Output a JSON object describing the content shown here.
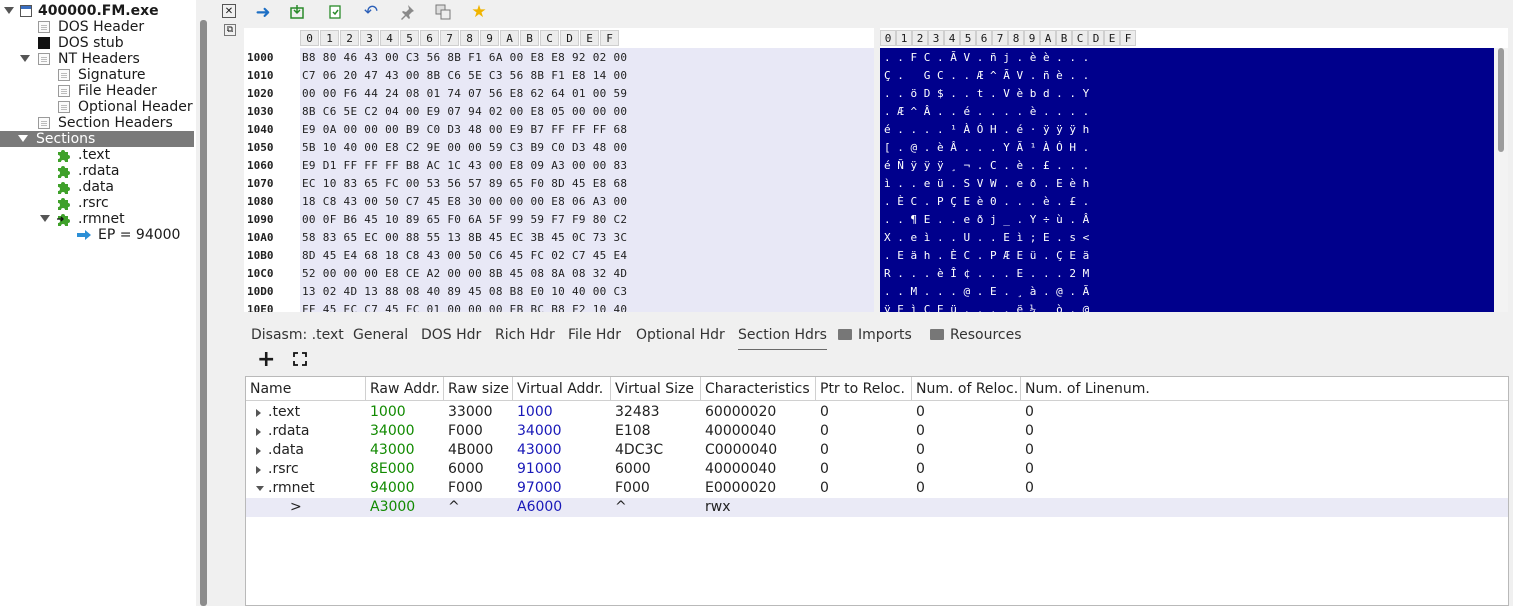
{
  "tree": {
    "root": "400000.FM.exe",
    "dos_header": "DOS Header",
    "dos_stub": "DOS stub",
    "nt_headers": "NT Headers",
    "signature": "Signature",
    "file_header": "File Header",
    "optional_header": "Optional Header",
    "section_headers": "Section Headers",
    "sections": "Sections",
    "text": ".text",
    "rdata": ".rdata",
    "data": ".data",
    "rsrc": ".rsrc",
    "rmnet": ".rmnet",
    "ep": "EP = 94000"
  },
  "toolbar": {
    "icons": [
      "close-icon",
      "forward-arrow-icon",
      "load-icon",
      "save-icon",
      "undo-icon",
      "pin-icon",
      "copy-icon",
      "star-icon",
      "restore-icon"
    ]
  },
  "hex": {
    "columns": [
      "0",
      "1",
      "2",
      "3",
      "4",
      "5",
      "6",
      "7",
      "8",
      "9",
      "A",
      "B",
      "C",
      "D",
      "E",
      "F"
    ],
    "rows": [
      {
        "addr": "1000",
        "bytes": "B8 80 46 43 00 C3 56 8B F1 6A 00 E8 E8 92 02 00",
        "ascii": ". . F C . Ã V . ñ j . è è . . ."
      },
      {
        "addr": "1010",
        "bytes": "C7 06 20 47 43 00 8B C6 5E C3 56 8B F1 E8 14 00",
        "ascii": "Ç .   G C . . Æ ^ Ã V . ñ è . ."
      },
      {
        "addr": "1020",
        "bytes": "00 00 F6 44 24 08 01 74 07 56 E8 62 64 01 00 59",
        "ascii": ". . ö D $ . . t . V è b d . . Y"
      },
      {
        "addr": "1030",
        "bytes": "8B C6 5E C2 04 00 E9 07 94 02 00 E8 05 00 00 00",
        "ascii": ". Æ ^ Â . . é . . . . è . . . ."
      },
      {
        "addr": "1040",
        "bytes": "E9 0A 00 00 00 B9 C0 D3 48 00 E9 B7 FF FF FF 68",
        "ascii": "é . . . . ¹ À Ó H . é · ÿ ÿ ÿ h"
      },
      {
        "addr": "1050",
        "bytes": "5B 10 40 00 E8 C2 9E 00 00 59 C3 B9 C0 D3 48 00",
        "ascii": "[ . @ . è Â . . . Y Ã ¹ À Ó H ."
      },
      {
        "addr": "1060",
        "bytes": "E9 D1 FF FF FF B8 AC 1C 43 00 E8 09 A3 00 00 83",
        "ascii": "é Ñ ÿ ÿ ÿ ¸ ¬ . C . è . £ . . ."
      },
      {
        "addr": "1070",
        "bytes": "EC 10 83 65 FC 00 53 56 57 89 65 F0 8D 45 E8 68",
        "ascii": "ì . . e ü . S V W . e ð . E è h"
      },
      {
        "addr": "1080",
        "bytes": "18 C8 43 00 50 C7 45 E8 30 00 00 00 E8 06 A3 00",
        "ascii": ". È C . P Ç E è 0 . . . è . £ ."
      },
      {
        "addr": "1090",
        "bytes": "00 0F B6 45 10 89 65 F0 6A 5F 99 59 F7 F9 80 C2",
        "ascii": ". . ¶ E . . e ð j _ . Y ÷ ù . Â"
      },
      {
        "addr": "10A0",
        "bytes": "58 83 65 EC 00 88 55 13 8B 45 EC 3B 45 0C 73 3C",
        "ascii": "X . e ì . . U . . E ì ; E . s <"
      },
      {
        "addr": "10B0",
        "bytes": "8D 45 E4 68 18 C8 43 00 50 C6 45 FC 02 C7 45 E4",
        "ascii": ". E ä h . È C . P Æ E ü . Ç E ä"
      },
      {
        "addr": "10C0",
        "bytes": "52 00 00 00 E8 CE A2 00 00 8B 45 08 8A 08 32 4D",
        "ascii": "R . . . è Î ¢ . . . E . . . 2 M"
      },
      {
        "addr": "10D0",
        "bytes": "13 02 4D 13 88 08 40 89 45 08 B8 E0 10 40 00 C3",
        "ascii": ". . M . . . @ . E . ¸ à . @ . Ã"
      },
      {
        "addr": "10E0",
        "bytes": "FF 45 EC C7 45 FC 01 00 00 00 EB BC B8 F2 10 40",
        "ascii": "ÿ E ì Ç E ü . . . . ë ¼ ¸ ò . @"
      }
    ]
  },
  "tabs": [
    "Disasm: .text",
    "General",
    "DOS Hdr",
    "Rich Hdr",
    "File Hdr",
    "Optional Hdr",
    "Section Hdrs",
    "Imports",
    "Resources"
  ],
  "active_tab": "Section Hdrs",
  "section_table": {
    "columns": [
      "Name",
      "Raw Addr.",
      "Raw size",
      "Virtual Addr.",
      "Virtual Size",
      "Characteristics",
      "Ptr to Reloc.",
      "Num. of Reloc.",
      "Num. of Linenum."
    ],
    "rows": [
      {
        "name": ".text",
        "raw_addr": "1000",
        "raw_size": "33000",
        "virt_addr": "1000",
        "virt_size": "32483",
        "chars": "60000020",
        "ptr_reloc": "0",
        "num_reloc": "0",
        "num_linenum": "0"
      },
      {
        "name": ".rdata",
        "raw_addr": "34000",
        "raw_size": "F000",
        "virt_addr": "34000",
        "virt_size": "E108",
        "chars": "40000040",
        "ptr_reloc": "0",
        "num_reloc": "0",
        "num_linenum": "0"
      },
      {
        "name": ".data",
        "raw_addr": "43000",
        "raw_size": "4B000",
        "virt_addr": "43000",
        "virt_size": "4DC3C",
        "chars": "C0000040",
        "ptr_reloc": "0",
        "num_reloc": "0",
        "num_linenum": "0"
      },
      {
        "name": ".rsrc",
        "raw_addr": "8E000",
        "raw_size": "6000",
        "virt_addr": "91000",
        "virt_size": "6000",
        "chars": "40000040",
        "ptr_reloc": "0",
        "num_reloc": "0",
        "num_linenum": "0"
      },
      {
        "name": ".rmnet",
        "raw_addr": "94000",
        "raw_size": "F000",
        "virt_addr": "97000",
        "virt_size": "F000",
        "chars": "E0000020",
        "ptr_reloc": "0",
        "num_reloc": "0",
        "num_linenum": "0"
      }
    ],
    "sub_row": {
      "marker": ">",
      "raw_addr": "A3000",
      "raw_size": "^",
      "virt_addr": "A6000",
      "virt_size": "^",
      "chars": "rwx"
    }
  },
  "panel_toolbar": {
    "add_icon": "plus-icon",
    "fit_icon": "expand-icon"
  },
  "colors": {
    "ascii_bg": "#00008c",
    "hex_bg": "#e8e8f6",
    "raw_addr": "#118a00",
    "virt_addr": "#1818b8",
    "selected_tree": "#7a7a7a"
  }
}
